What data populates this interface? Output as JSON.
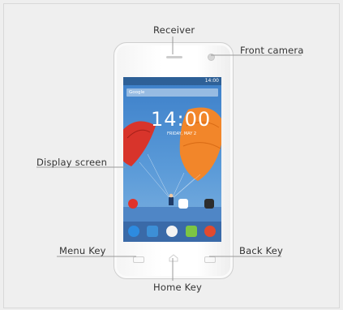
{
  "labels": {
    "receiver": "Receiver",
    "front_camera": "Front camera",
    "display_screen": "Display screen",
    "menu_key": "Menu Key",
    "back_key": "Back Key",
    "home_key": "Home Key"
  },
  "screen": {
    "status_time": "14:00",
    "search_placeholder": "Google",
    "clock": "14:00",
    "date": "FRIDAY, MAY 2"
  },
  "colors": {
    "leader_line": "#9a9a9a",
    "label_text": "#333333"
  }
}
